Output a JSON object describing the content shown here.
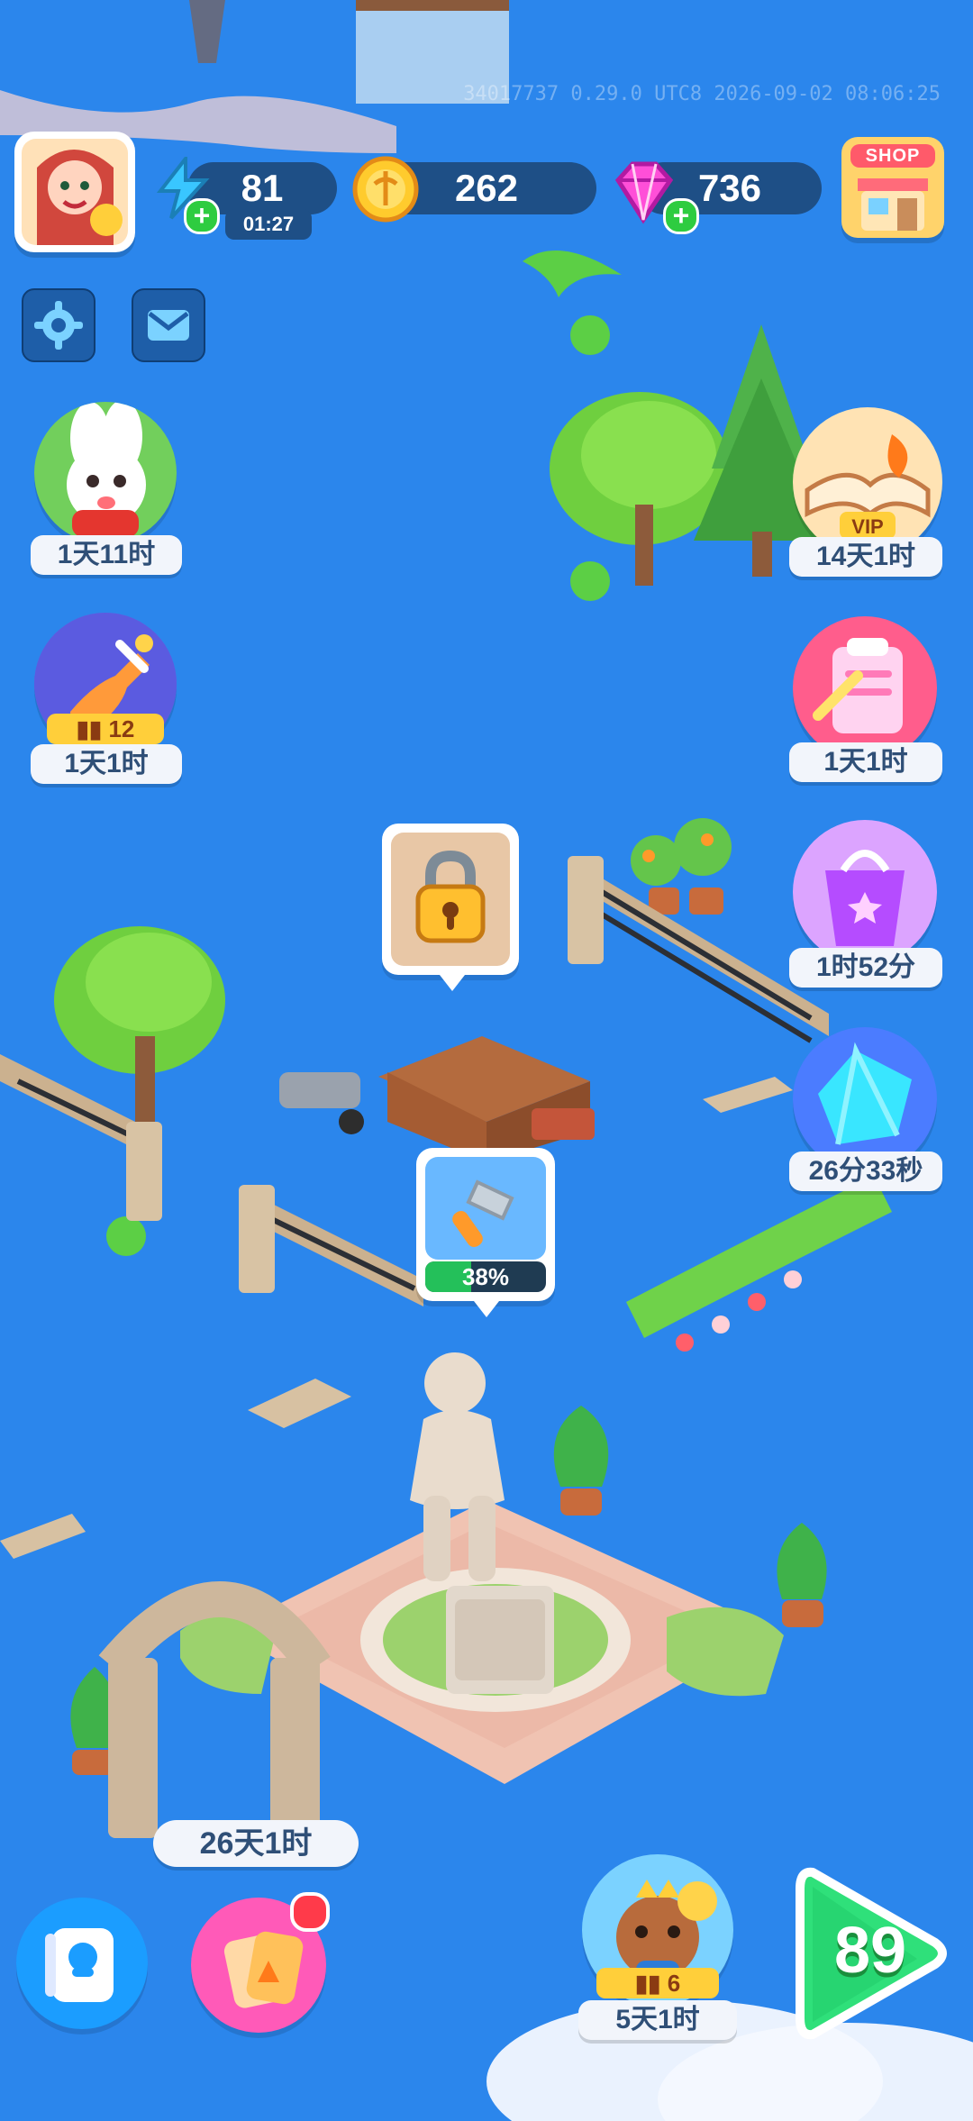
{
  "debug_text": "34017737 0.29.0 UTC8 2026-09-02 08:06:25",
  "hud": {
    "energy": {
      "value": "81",
      "timer": "01:27"
    },
    "coins": {
      "value": "262"
    },
    "gems": {
      "value": "736"
    },
    "shop_label": "SHOP"
  },
  "side_left": {
    "event1": {
      "timer": "1天11时"
    },
    "event2": {
      "badge": "12",
      "timer": "1天1时"
    }
  },
  "side_right": {
    "vip": {
      "badge": "VIP",
      "timer": "14天1时"
    },
    "notes": {
      "timer": "1天1时"
    },
    "bag": {
      "timer": "1时52分"
    },
    "gem_event": {
      "timer": "26分33秒"
    }
  },
  "world": {
    "progress": {
      "percent_label": "38%",
      "value": 38
    }
  },
  "bottom": {
    "event_timer": "26天1时",
    "right_event": {
      "badge": "6",
      "timer": "5天1时"
    },
    "play_level": "89"
  },
  "colors": {
    "sky": "#2b86ec",
    "hud": "#1e4f86",
    "accent_green": "#24c05a",
    "gold": "#ffcf3a"
  }
}
